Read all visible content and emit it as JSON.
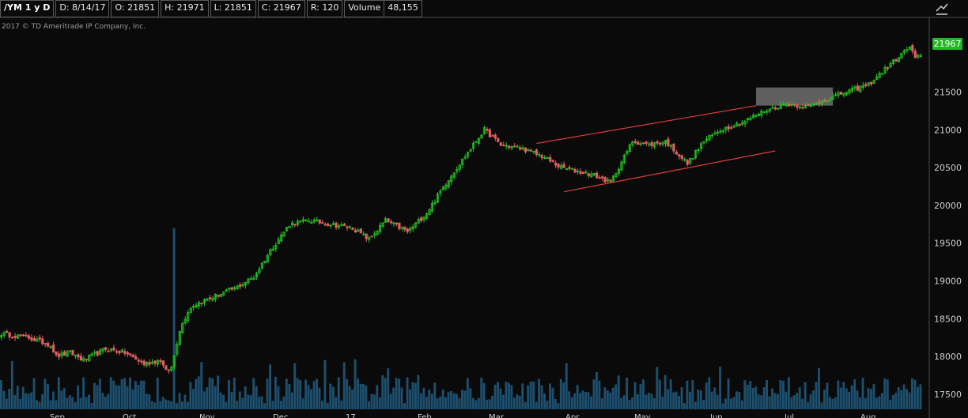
{
  "header": {
    "symbol": "/YM 1 y D",
    "date": "D: 8/14/17",
    "open": "O: 21851",
    "high": "H: 21971",
    "low": "L: 21851",
    "close": "C: 21967",
    "range": "R: 120",
    "volume_label": "Volume",
    "volume_value": "48,155"
  },
  "copyright": "2017 © TD Ameritrade IP Company, Inc.",
  "last_price_tag": "21967",
  "icons": {
    "draw_tool": "trendline-icon"
  },
  "colors": {
    "up": "#22c522",
    "down": "#e06060",
    "volume": "#1d4f6e",
    "trendline": "#e03c3c",
    "highlight": "#6e6e6e",
    "price_tag": "#23b923",
    "background": "#0a0a0a"
  },
  "chart_data": {
    "type": "candlestick",
    "x_tick_labels": [
      "Sep",
      "Oct",
      "Nov",
      "Dec",
      "17",
      "Feb",
      "Mar",
      "Apr",
      "May",
      "Jun",
      "Jul",
      "Aug"
    ],
    "y_tick_labels": [
      "21500",
      "21000",
      "20500",
      "20000",
      "19500",
      "19000",
      "18500",
      "18000",
      "17500"
    ],
    "ylim": [
      17300,
      22300
    ],
    "price_path": [
      [
        0,
        18300
      ],
      [
        10,
        18250
      ],
      [
        18,
        18150
      ],
      [
        20,
        18000
      ],
      [
        25,
        18050
      ],
      [
        30,
        17950
      ],
      [
        38,
        18100
      ],
      [
        45,
        18050
      ],
      [
        52,
        17900
      ],
      [
        58,
        17950
      ],
      [
        60,
        17800
      ],
      [
        62,
        17850
      ],
      [
        65,
        18350
      ],
      [
        68,
        18600
      ],
      [
        70,
        18680
      ],
      [
        78,
        18800
      ],
      [
        85,
        18900
      ],
      [
        92,
        19050
      ],
      [
        98,
        19400
      ],
      [
        105,
        19750
      ],
      [
        112,
        19800
      ],
      [
        120,
        19750
      ],
      [
        128,
        19700
      ],
      [
        134,
        19550
      ],
      [
        140,
        19800
      ],
      [
        148,
        19650
      ],
      [
        155,
        19900
      ],
      [
        163,
        20350
      ],
      [
        170,
        20700
      ],
      [
        176,
        21000
      ],
      [
        182,
        20800
      ],
      [
        190,
        20750
      ],
      [
        197,
        20650
      ],
      [
        204,
        20500
      ],
      [
        210,
        20450
      ],
      [
        216,
        20400
      ],
      [
        222,
        20300
      ],
      [
        230,
        20850
      ],
      [
        236,
        20800
      ],
      [
        242,
        20850
      ],
      [
        250,
        20550
      ],
      [
        256,
        20850
      ],
      [
        262,
        21000
      ],
      [
        270,
        21100
      ],
      [
        278,
        21250
      ],
      [
        286,
        21350
      ],
      [
        294,
        21300
      ],
      [
        300,
        21400
      ],
      [
        308,
        21500
      ],
      [
        316,
        21600
      ],
      [
        322,
        21800
      ],
      [
        328,
        22000
      ],
      [
        331,
        22100
      ],
      [
        333,
        21950
      ],
      [
        335,
        21967
      ]
    ],
    "volume_spike": {
      "bar": 63,
      "value": 19700
    },
    "channel": {
      "upper": [
        [
          195,
          20820
        ],
        [
          275,
          21320
        ]
      ],
      "lower": [
        [
          205,
          20180
        ],
        [
          282,
          20720
        ]
      ]
    },
    "consolidation_box": {
      "x": [
        275,
        303
      ],
      "y": [
        21320,
        21560
      ]
    }
  }
}
